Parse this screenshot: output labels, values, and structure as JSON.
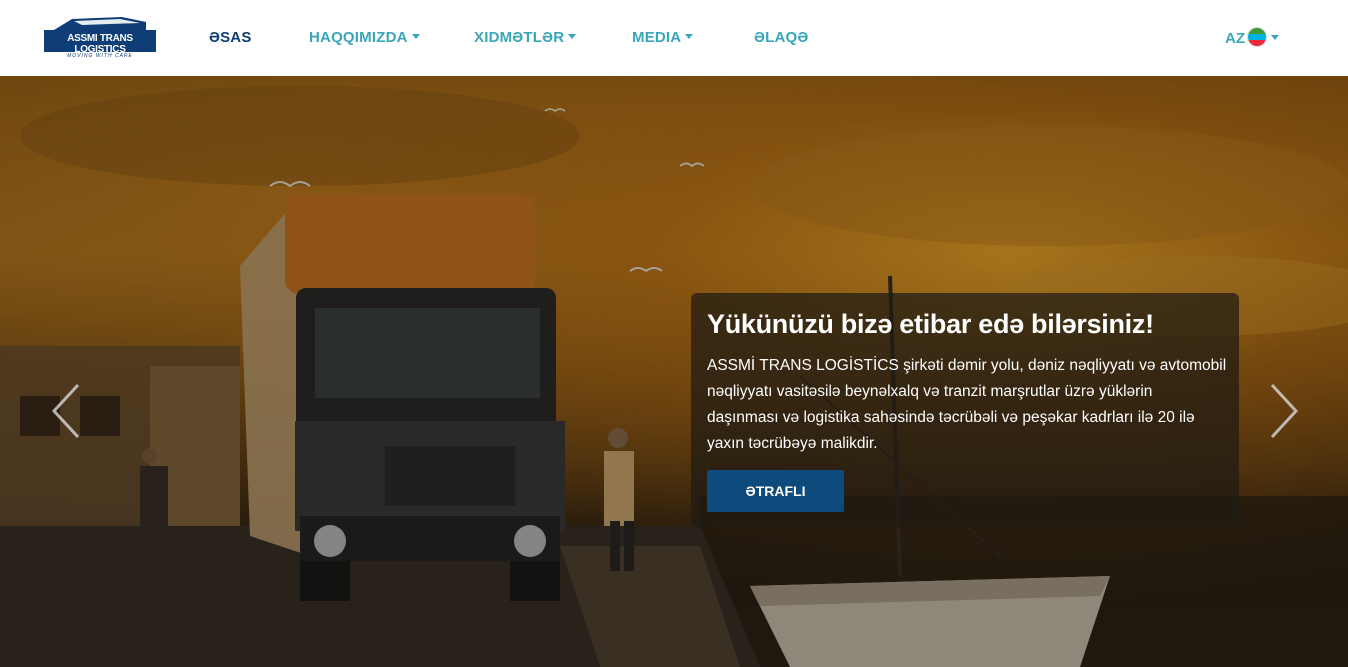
{
  "brand": {
    "name": "ASSMI TRANS LOGISTICS",
    "tagline": "MOVING WITH CARE"
  },
  "nav": {
    "items": [
      {
        "label": "ƏSAS",
        "active": true,
        "dropdown": false
      },
      {
        "label": "HAQQIMIZDA",
        "active": false,
        "dropdown": true
      },
      {
        "label": "XIDMƏTLƏR",
        "active": false,
        "dropdown": true
      },
      {
        "label": "MEDIA",
        "active": false,
        "dropdown": true
      },
      {
        "label": "ƏLAQƏ",
        "active": false,
        "dropdown": false
      }
    ],
    "language": "AZ"
  },
  "hero": {
    "title": "Yükünüzü bizə etibar edə bilərsiniz!",
    "text": "ASSMİ TRANS LOGİSTİCS şirkəti dəmir yolu, dəniz nəqliyyatı və avtomobil nəqliyyatı vasitəsilə beynəlxalq və tranzit marşrutlar üzrə yüklərin daşınması və logistika sahəsində təcrübəli və peşəkar kadrları ilə 20 ilə yaxın təcrübəyə malikdir.",
    "button_label": "ƏTRAFLI"
  },
  "colors": {
    "primary": "#0e3d78",
    "accent": "#3aa6b9",
    "button": "#0e4a7c"
  },
  "icons": {
    "prev": "chevron-left-icon",
    "next": "chevron-right-icon",
    "flag": "azerbaijan-flag-icon"
  }
}
